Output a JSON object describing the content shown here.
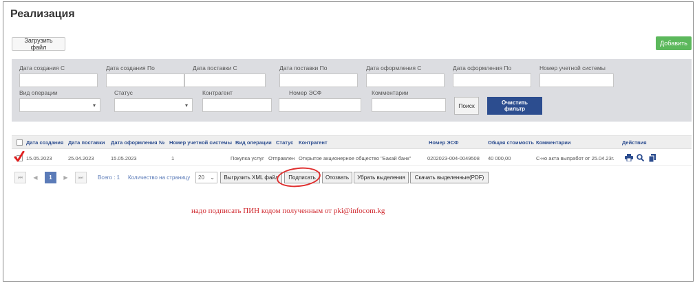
{
  "page": {
    "title": "Реализация"
  },
  "toolbar": {
    "upload_label": "Загрузить файл",
    "add_label": "Добавить"
  },
  "filters": {
    "row1": [
      {
        "label": "Дата создания С",
        "value": ""
      },
      {
        "label": "Дата создания По",
        "value": ""
      },
      {
        "label": "Дата поставки С",
        "value": ""
      },
      {
        "label": "Дата поставки По",
        "value": ""
      },
      {
        "label": "Дата оформления С",
        "value": ""
      },
      {
        "label": "Дата оформления По",
        "value": ""
      },
      {
        "label": "Номер учетной системы",
        "value": ""
      }
    ],
    "row2": [
      {
        "label": "Вид операции",
        "value": ""
      },
      {
        "label": "Статус",
        "value": ""
      },
      {
        "label": "Контрагент",
        "value": ""
      },
      {
        "label": "Номер ЭСФ",
        "value": ""
      },
      {
        "label": "Комментарии",
        "value": ""
      }
    ],
    "search_label": "Поиск",
    "clear_label": "Очистить фильтр"
  },
  "table": {
    "headers": [
      "Дата создания",
      "Дата поставки",
      "Дата оформления",
      "№",
      "Номер учетной системы",
      "Вид операции",
      "Статус",
      "Контрагент",
      "Номер ЭСФ",
      "Общая стоимость",
      "Комментарии",
      "Действия"
    ],
    "rows": [
      {
        "created": "15.05.2023",
        "delivery": "25.04.2023",
        "registered": "15.05.2023",
        "number": "1",
        "account_no": "",
        "operation": "Покупка услуг",
        "status": "Отправлен",
        "counterparty": "Открытое акционерное общество \"Бакай банк\"",
        "esf_number": "0202023-004-0049508",
        "total": "40 000,00",
        "comment": "С-но акта выпработ от 25.04.23г.",
        "checked": true
      }
    ]
  },
  "pager": {
    "current_page": "1",
    "total_text": "Всего : 1",
    "per_page_label": "Количество на страницу",
    "per_page_value": "20",
    "first_icon": "first-page-icon",
    "prev_icon": "prev-page-icon",
    "next_icon": "next-page-icon",
    "last_icon": "last-page-icon"
  },
  "actions": {
    "export_xml": "Выгрузить XML файл",
    "sign": "Подписать",
    "revoke": "Отозвать",
    "clear_selection": "Убрать выделения",
    "download_pdf": "Скачать выделенные(PDF)"
  },
  "annotation": {
    "note": "надо подписать ПИН кодом полученным от pki@infocom.kg",
    "color": "#d0282e"
  },
  "colors": {
    "accent": "#2c4d8f",
    "add_button": "#5cb85c",
    "filter_panel": "#dcdde1"
  }
}
